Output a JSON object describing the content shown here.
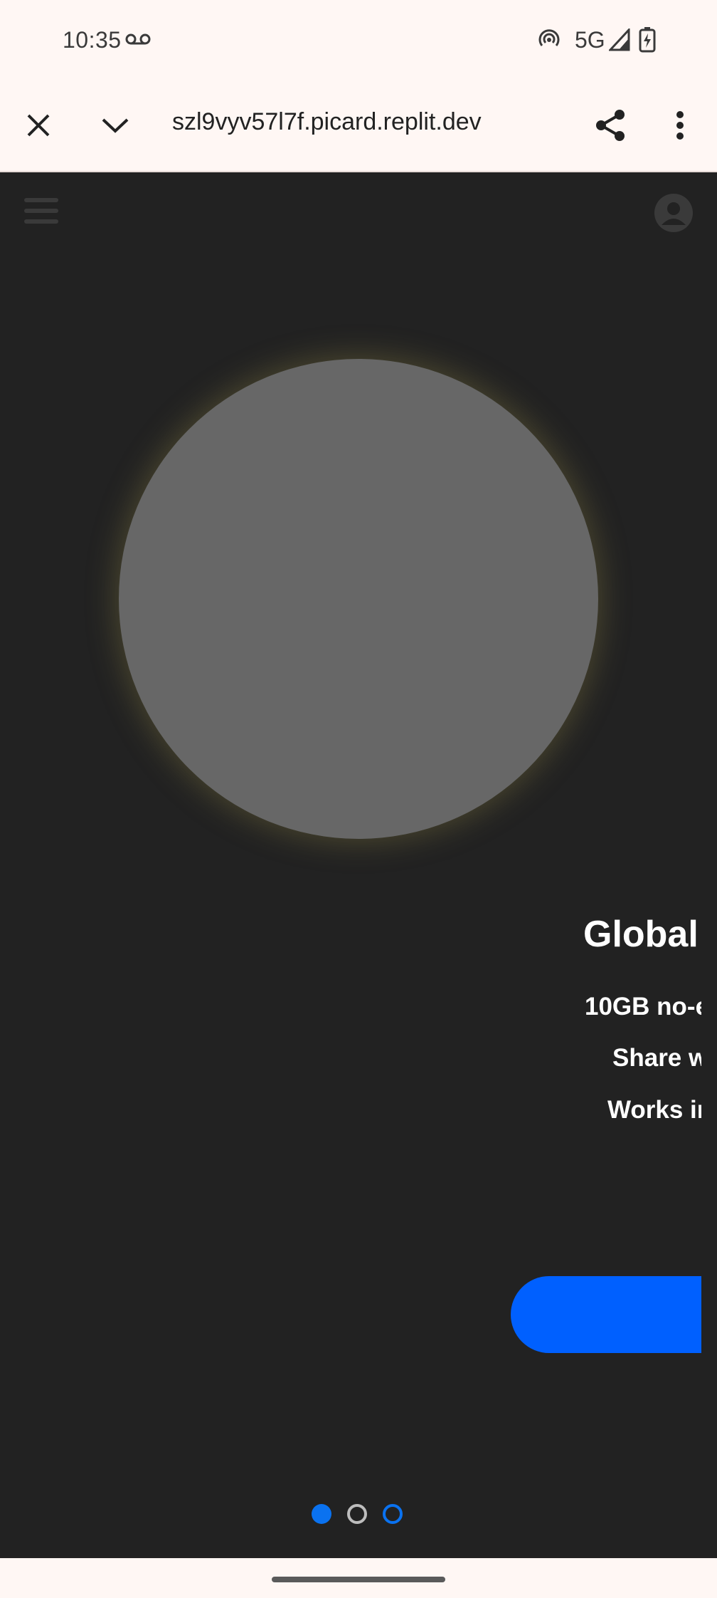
{
  "status_bar": {
    "time": "10:35",
    "network": "5G",
    "icons": [
      "voicemail-icon",
      "hotspot-icon",
      "signal-icon",
      "battery-charging-icon"
    ]
  },
  "browser_toolbar": {
    "url": "szl9vyv57l7f.picard.replit.dev",
    "icons": [
      "close-icon",
      "chevron-down-icon",
      "share-icon",
      "more-vert-icon"
    ]
  },
  "app": {
    "icons": [
      "hamburger-menu-icon",
      "account-icon"
    ],
    "slide": {
      "title": "Global",
      "features": [
        "10GB no-e",
        "Share w",
        "Works ir"
      ]
    },
    "pager": {
      "total": 3,
      "active": 1
    },
    "colors": {
      "background": "#222222",
      "accent": "#0060ff",
      "circle": "#676767"
    }
  }
}
